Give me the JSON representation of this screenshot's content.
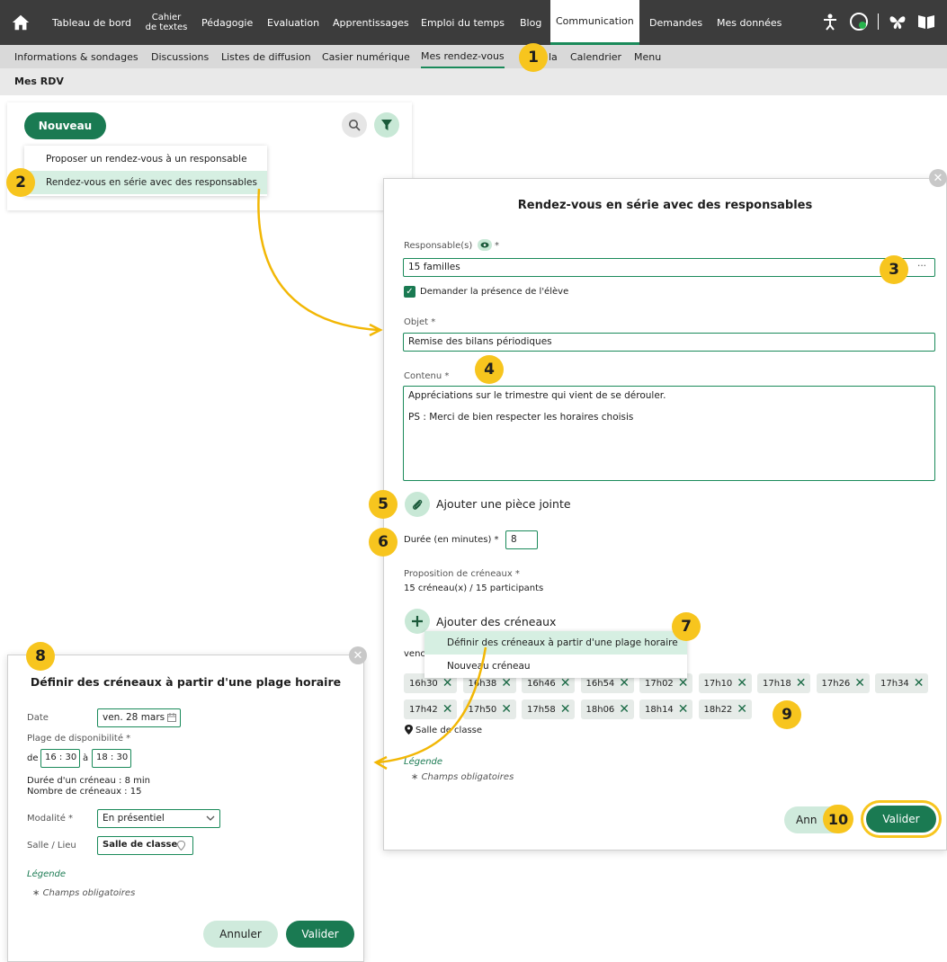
{
  "topnav": {
    "items": [
      "Tableau de bord",
      "Cahier de textes",
      "Pédagogie",
      "Evaluation",
      "Apprentissages",
      "Emploi du temps",
      "Blog",
      "Communication",
      "Demandes",
      "Mes données"
    ],
    "cahier_line1": "Cahier",
    "cahier_line2": "de textes",
    "active": "Communication"
  },
  "subnav": {
    "items": [
      "Informations & sondages",
      "Discussions",
      "Listes de diffusion",
      "Casier numérique",
      "Mes rendez-vous",
      "la",
      "Calendrier",
      "Menu"
    ],
    "active": "Mes rendez-vous"
  },
  "breadcrumb": "Mes RDV",
  "left": {
    "new_button": "Nouveau",
    "menu": [
      "Proposer un rendez-vous à un responsable",
      "Rendez-vous en série avec des responsables"
    ]
  },
  "dialog": {
    "title": "Rendez-vous en série avec des responsables",
    "responsables_label": "Responsable(s)",
    "required_mark": "*",
    "responsables_value": "15 familles",
    "more_button": "···",
    "presence_label": "Demander la présence de l'élève",
    "objet_label": "Objet *",
    "objet_value": "Remise des bilans périodiques",
    "contenu_label": "Contenu *",
    "contenu_line1": "Appréciations sur le trimestre qui vient de se dérouler.",
    "contenu_line2": "PS : Merci de bien respecter les horaires choisis",
    "attach_label": "Ajouter une pièce jointe",
    "duree_label": "Durée (en minutes) *",
    "duree_value": "8",
    "creneaux_label": "Proposition de créneaux *",
    "creneaux_count": "15 créneau(x) / 15 participants",
    "add_slots_label": "Ajouter des créneaux",
    "submenu": [
      "Définir des créneaux à partir d'une plage horaire",
      "Nouveau créneau"
    ],
    "day_prefix": "venc",
    "slots_row1": [
      "16h30",
      "16h38",
      "16h46",
      "16h54",
      "17h02",
      "17h10",
      "17h18",
      "17h26",
      "17h34"
    ],
    "slots_row2": [
      "17h42",
      "17h50",
      "17h58",
      "18h06",
      "18h14",
      "18h22"
    ],
    "room": "Salle de classe",
    "legend_title": "Légende",
    "legend_text": "Champs obligatoires",
    "cancel": "Annuler",
    "cancel_visible": "Ann",
    "ok": "Valider"
  },
  "small_dialog": {
    "title": "Définir des créneaux à partir d'une plage horaire",
    "date_label": "Date",
    "date_value": "ven. 28 mars",
    "plage_label": "Plage de disponibilité *",
    "de": "de",
    "start_h": "16",
    "start_m": "30",
    "a": "à",
    "end_h": "18",
    "end_m": "30",
    "duree_line": "Durée d'un créneau : 8 min",
    "nombre_line": "Nombre de créneaux : 15",
    "modalite_label": "Modalité *",
    "modalite_value": "En présentiel",
    "salle_label": "Salle / Lieu",
    "salle_value": "Salle de classe",
    "legend_title": "Légende",
    "legend_text": "Champs obligatoires",
    "cancel": "Annuler",
    "ok": "Valider"
  },
  "badges": [
    "1",
    "2",
    "3",
    "4",
    "5",
    "6",
    "7",
    "8",
    "9",
    "10"
  ],
  "colors": {
    "accent": "#1a7a52",
    "badge": "#f7c51e",
    "arrow": "#f2b705",
    "nav_bg": "#3c3c3c"
  }
}
